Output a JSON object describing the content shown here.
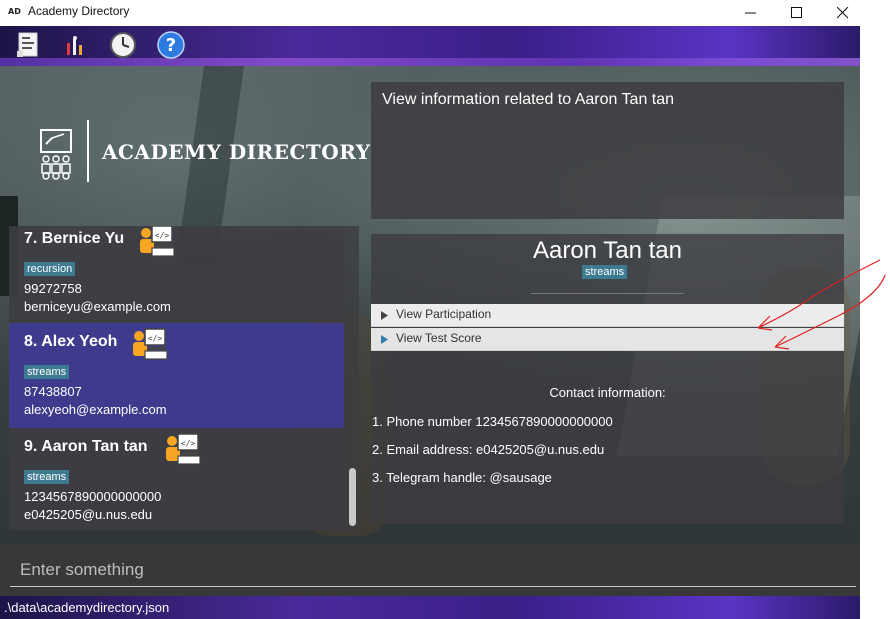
{
  "window": {
    "badge": "AD",
    "title": "Academy Directory"
  },
  "toolbar": {
    "icons": [
      "notes-icon",
      "stats-icon",
      "clock-icon",
      "help-icon"
    ]
  },
  "logo": {
    "title": "ACADEMY DIRECTORY"
  },
  "persons": [
    {
      "name": "7.  Bernice Yu",
      "tag": "recursion",
      "phone": "99272758",
      "email": "berniceyu@example.com"
    },
    {
      "name": "8.  Alex Yeoh",
      "tag": "streams",
      "phone": "87438807",
      "email": "alexyeoh@example.com"
    },
    {
      "name": "9.  Aaron Tan tan",
      "tag": "streams",
      "phone": "1234567890000000000",
      "email": "e0425205@u.nus.edu"
    }
  ],
  "result": {
    "text": "View information related to Aaron Tan tan"
  },
  "detail": {
    "name": "Aaron Tan tan",
    "tag": "streams",
    "accordion": [
      "View Participation",
      "View Test Score"
    ],
    "contact_title": "Contact information:",
    "contact_lines": [
      "1. Phone number 1234567890000000000",
      "2. Email address: e0425205@u.nus.edu",
      "3. Telegram handle: @sausage"
    ]
  },
  "command": {
    "placeholder": "Enter something"
  },
  "status": {
    "path": ".\\data\\academydirectory.json"
  },
  "colors": {
    "tag": "#3e7b91",
    "selected_card": "#3f3b8c",
    "annotation": "#e02020"
  }
}
